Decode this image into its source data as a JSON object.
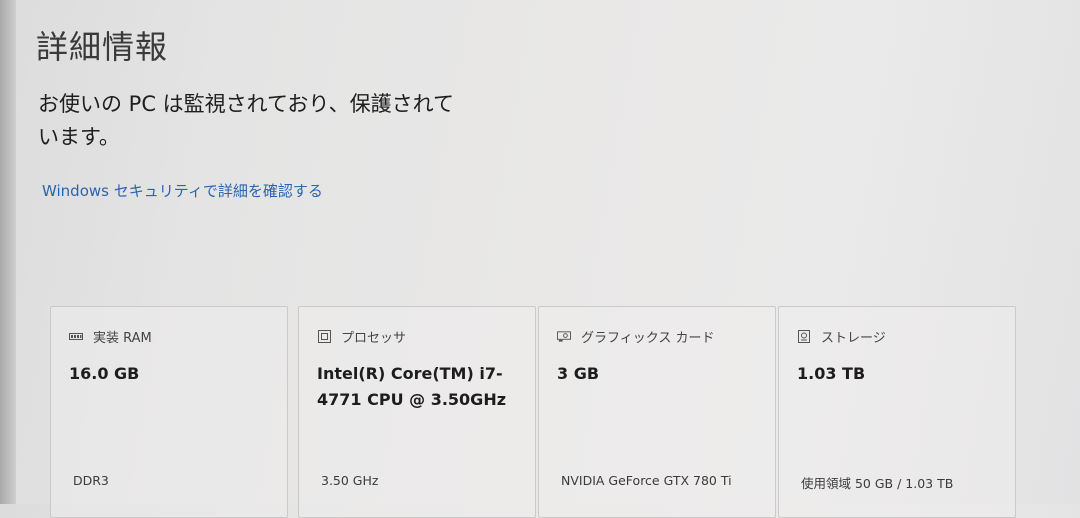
{
  "header": {
    "title": "詳細情報"
  },
  "protection": {
    "status_text": "お使いの PC は監視されており、保護されています。",
    "link_label": "Windows セキュリティで詳細を確認する"
  },
  "specs": [
    {
      "icon": "memory-icon",
      "label": "実装 RAM",
      "value": "16.0 GB",
      "detail": "DDR3"
    },
    {
      "icon": "processor-icon",
      "label": "プロセッサ",
      "value": "Intel(R) Core(TM) i7-4771 CPU @ 3.50GHz",
      "detail": "3.50 GHz"
    },
    {
      "icon": "graphics-card-icon",
      "label": "グラフィックス カード",
      "value": "3 GB",
      "detail": "NVIDIA GeForce GTX 780 Ti"
    },
    {
      "icon": "storage-icon",
      "label": "ストレージ",
      "value": "1.03 TB",
      "detail": "使用領域 50 GB / 1.03 TB"
    }
  ]
}
